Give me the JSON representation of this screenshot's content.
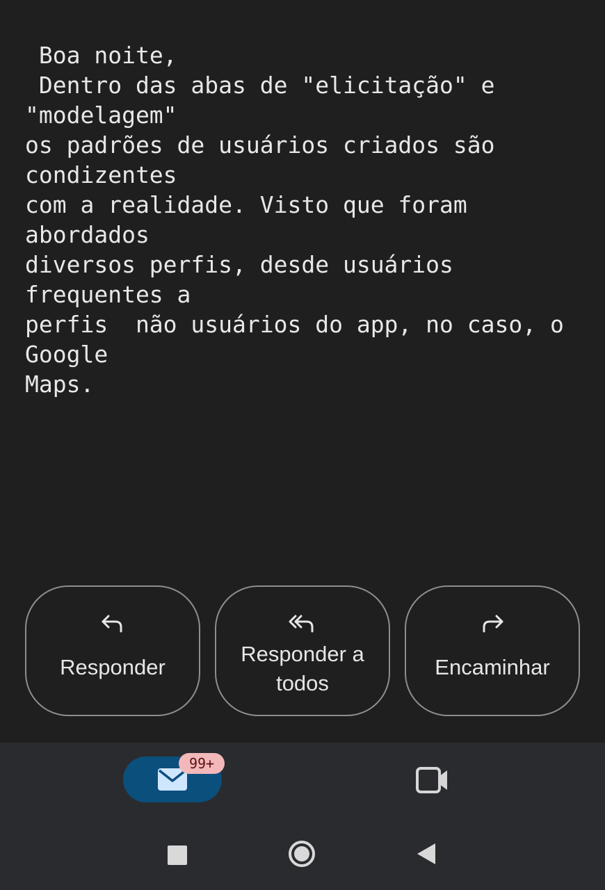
{
  "email": {
    "body_lines": [
      " Boa noite,",
      " Dentro das abas de \"elicitação\" e \"modelagem\"",
      "os padrões de usuários criados são condizentes",
      "com a realidade. Visto que foram abordados",
      "diversos perfis, desde usuários frequentes a",
      "perfis  não usuários do app, no caso, o Google",
      "Maps."
    ]
  },
  "actions": {
    "reply_label": "Responder",
    "reply_all_label": "Responder a\ntodos",
    "forward_label": "Encaminhar",
    "reply_icon": "reply-icon",
    "reply_all_icon": "reply-all-icon",
    "forward_icon": "forward-icon"
  },
  "bottom_nav": {
    "mail_icon": "mail-icon",
    "mail_badge": "99+",
    "meet_icon": "video-camera-icon",
    "colors": {
      "active_pill": "#0b4f7d",
      "badge_bg": "#f3b8ba",
      "nav_bg": "#2a2b2f"
    }
  },
  "system_nav": {
    "recents_icon": "square-recents-icon",
    "home_icon": "circle-home-icon",
    "back_icon": "triangle-back-icon"
  }
}
